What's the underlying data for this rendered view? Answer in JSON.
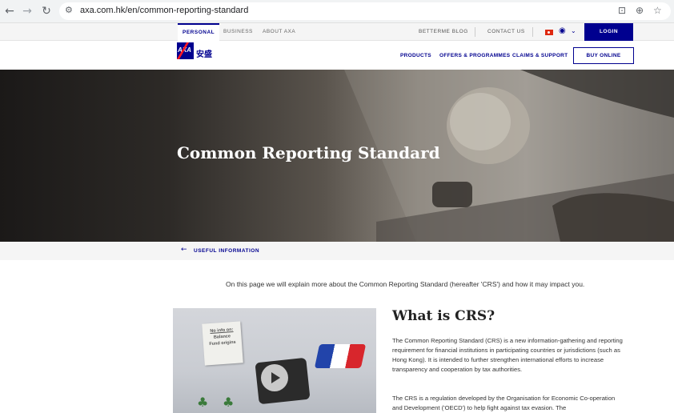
{
  "browser": {
    "url": "axa.com.hk/en/common-reporting-standard"
  },
  "utilbar": {
    "tabs": [
      "PERSONAL",
      "BUSINESS",
      "ABOUT AXA"
    ],
    "links": [
      "BETTERME BLOG",
      "CONTACT US"
    ],
    "login": "LOGIN"
  },
  "mainnav": {
    "logo_text": "AXA",
    "logo_cn": "安盛",
    "links": [
      "PRODUCTS",
      "OFFERS & PROGRAMMES",
      "CLAIMS & SUPPORT"
    ],
    "buy_online": "BUY ONLINE"
  },
  "hero": {
    "title": "Common Reporting Standard"
  },
  "breadcrumb": {
    "label": "USEFUL INFORMATION"
  },
  "content": {
    "intro": "On this page we will explain more about the Common Reporting Standard (hereafter 'CRS') and how it may impact you.",
    "video_note": [
      "No info on:",
      "Balance",
      "Fund origins"
    ],
    "section_title": "What is CRS?",
    "para1": "The Common Reporting Standard (CRS) is a new information-gathering and reporting requirement for financial institutions in participating countries or jurisdictions (such as Hong Kong). It is intended to further strengthen international efforts to increase transparency and cooperation by tax authorities.",
    "para2": "The CRS is a regulation developed by the Organisation for Economic Co-operation and Development ('OECD') to help fight against tax evasion. The"
  },
  "colors": {
    "axa_blue": "#00008f",
    "axa_red": "#ff1721"
  }
}
